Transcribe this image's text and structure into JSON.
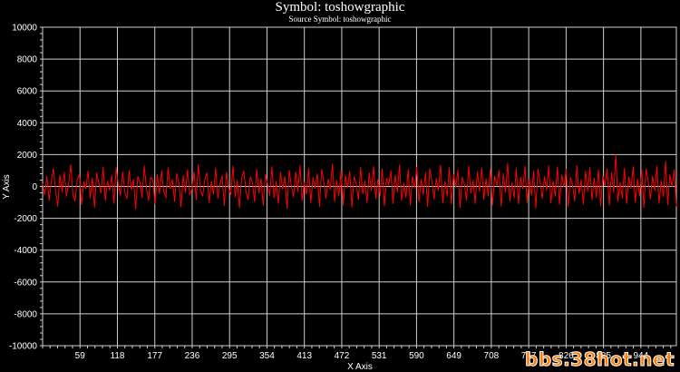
{
  "chart_data": {
    "type": "line",
    "title": "Symbol: toshowgraphic",
    "subtitle": "Source Symbol: toshowgraphic",
    "xlabel": "X Axis",
    "ylabel": "Y Axis",
    "ylim": [
      -10000,
      10000
    ],
    "xlim": [
      0,
      1000
    ],
    "y_ticks": [
      "10000",
      "8000",
      "6000",
      "4000",
      "2000",
      "0",
      "-2000",
      "-4000",
      "-6000",
      "-8000",
      "-10000"
    ],
    "x_ticks": [
      "59",
      "118",
      "177",
      "236",
      "295",
      "354",
      "413",
      "472",
      "531",
      "590",
      "649",
      "708",
      "767",
      "826",
      "885",
      "944"
    ],
    "grid": true,
    "series": [
      {
        "color": "#ff0000",
        "values": [
          180,
          -520,
          640,
          -880,
          310,
          1120,
          -260,
          -1240,
          720,
          -340,
          890,
          -610,
          120,
          1380,
          -480,
          -930,
          420,
          760,
          -1150,
          290,
          -150,
          980,
          -720,
          540,
          -1320,
          860,
          190,
          -410,
          1210,
          -880,
          350,
          -240,
          670,
          -1060,
          1180,
          80,
          -560,
          920,
          -330,
          -780,
          1010,
          -210,
          460,
          -1420,
          630,
          270,
          -690,
          1290,
          -120,
          -870,
          580,
          380,
          -1110,
          740,
          -450,
          990,
          -300,
          -720,
          1180,
          -160,
          440,
          -940,
          820,
          210,
          -1290,
          690,
          -380,
          1060,
          -520,
          -170,
          930,
          -840,
          1370,
          -260,
          -610,
          480,
          860,
          -1030,
          320,
          -480,
          1160,
          -740,
          150,
          680,
          -1210,
          910,
          -90,
          -520,
          1280,
          -660,
          380,
          -1340,
          540,
          970,
          -280,
          -830,
          610,
          220,
          -960,
          1090,
          -400,
          480,
          -1180,
          770,
          130,
          -560,
          1240,
          -710,
          330,
          -1070,
          880,
          -180,
          620,
          -1390,
          1020,
          40,
          -650,
          900,
          -310,
          1320,
          -880,
          260,
          -480,
          1150,
          -1020,
          570,
          -130,
          790,
          -1260,
          1080,
          280,
          -740,
          460,
          -210,
          1410,
          -930,
          370,
          -580,
          1030,
          -1180,
          710,
          -60,
          940,
          -1300,
          620,
          180,
          -820,
          1190,
          -450,
          350,
          -1010,
          860,
          -270,
          1250,
          -760,
          430,
          -590,
          1100,
          -1230,
          520,
          90,
          980,
          -1080,
          700,
          -340,
          1360,
          -890,
          210,
          -690,
          1070,
          -1150,
          640,
          -100,
          1210,
          -970,
          450,
          -520,
          880,
          -1270,
          1120,
          260,
          -780,
          520,
          -230,
          1340,
          -1020,
          310,
          -640,
          1180,
          -1100,
          760,
          -40,
          1030,
          -1320,
          590,
          140,
          -870,
          1270,
          -420,
          400,
          -1060,
          930,
          -300,
          1160,
          -810,
          480,
          -610,
          1090,
          -1170,
          650,
          70,
          1010,
          -1240,
          820,
          -360,
          1450,
          -920,
          230,
          -710,
          1130,
          -1090,
          580,
          -160,
          1260,
          -1010,
          510,
          -550,
          960,
          -1350,
          1070,
          300,
          -760,
          620,
          -250,
          1300,
          -1040,
          340,
          -620,
          1220,
          -1130,
          720,
          -20,
          1080,
          -1280,
          560,
          110,
          -910,
          1310,
          -440,
          420,
          -1120,
          970,
          -320,
          1190,
          -850,
          530,
          -660,
          1040,
          -1210,
          690,
          50,
          1120,
          -1190,
          860,
          -380,
          1980,
          -940,
          250,
          -730,
          1150,
          -1070,
          600,
          -140,
          1230,
          -990,
          470,
          -580,
          1020,
          -1310,
          1100,
          330,
          -790,
          650,
          -270,
          1280,
          -1060,
          360,
          -630,
          1590,
          -1160,
          740,
          -10,
          1050,
          -1250
        ]
      }
    ]
  },
  "watermark": "bbs.38hot.net"
}
